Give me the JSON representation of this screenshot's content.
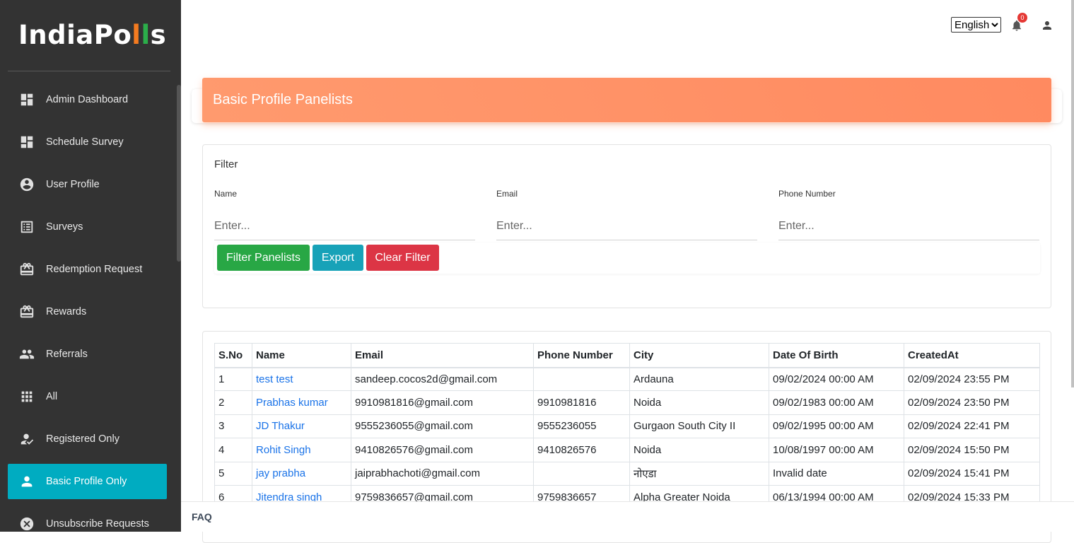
{
  "brand": {
    "logo_prefix": "IndiaPo",
    "logo_suffix": "s",
    "colors": {
      "orange": "#f47b20",
      "green": "#2bae4a",
      "accent": "#00acc1"
    }
  },
  "sidebar": {
    "items": [
      {
        "label": "Admin Dashboard",
        "icon": "dashboard-icon"
      },
      {
        "label": "Schedule Survey",
        "icon": "dashboard-icon"
      },
      {
        "label": "User Profile",
        "icon": "account-circle-icon"
      },
      {
        "label": "Surveys",
        "icon": "list-alt-icon"
      },
      {
        "label": "Redemption Request",
        "icon": "redeem-icon"
      },
      {
        "label": "Rewards",
        "icon": "redeem-icon"
      },
      {
        "label": "Referrals",
        "icon": "people-icon"
      },
      {
        "label": "All",
        "icon": "apps-icon"
      },
      {
        "label": "Registered Only",
        "icon": "how-to-reg-icon"
      },
      {
        "label": "Basic Profile Only",
        "icon": "person-icon",
        "active": true
      },
      {
        "label": "Unsubscribe Requests",
        "icon": "cancel-icon"
      }
    ]
  },
  "topbar": {
    "language": "English",
    "notification_count": "0"
  },
  "header": {
    "title": "Basic Profile Panelists"
  },
  "filter": {
    "title": "Filter",
    "fields": [
      {
        "label": "Name",
        "placeholder": "Enter..."
      },
      {
        "label": "Email",
        "placeholder": "Enter..."
      },
      {
        "label": "Phone Number",
        "placeholder": "Enter..."
      }
    ],
    "buttons": {
      "filter": "Filter Panelists",
      "export": "Export",
      "clear": "Clear Filter"
    }
  },
  "table": {
    "columns": [
      "S.No",
      "Name",
      "Email",
      "Phone Number",
      "City",
      "Date Of Birth",
      "CreatedAt"
    ],
    "rows": [
      [
        "1",
        "test test",
        "sandeep.cocos2d@gmail.com",
        "",
        "Ardauna",
        "09/02/2024 00:00 AM",
        "02/09/2024 23:55 PM"
      ],
      [
        "2",
        "Prabhas kumar",
        "9910981816@gmail.com",
        "9910981816",
        "Noida",
        "09/02/1983 00:00 AM",
        "02/09/2024 23:50 PM"
      ],
      [
        "3",
        "JD Thakur",
        "9555236055@gmail.com",
        "9555236055",
        "Gurgaon South City II",
        "09/02/1995 00:00 AM",
        "02/09/2024 22:41 PM"
      ],
      [
        "4",
        "Rohit Singh",
        "9410826576@gmail.com",
        "9410826576",
        "Noida",
        "10/08/1997 00:00 AM",
        "02/09/2024 15:50 PM"
      ],
      [
        "5",
        "jay prabha",
        "jaiprabhachoti@gmail.com",
        "",
        "नोएडा",
        "Invalid date",
        "02/09/2024 15:41 PM"
      ],
      [
        "6",
        "Jitendra singh",
        "9759836657@gmail.com",
        "9759836657",
        "Alpha Greater Noida",
        "06/13/1994 00:00 AM",
        "02/09/2024 15:33 PM"
      ]
    ]
  },
  "footer": {
    "faq": "FAQ"
  }
}
